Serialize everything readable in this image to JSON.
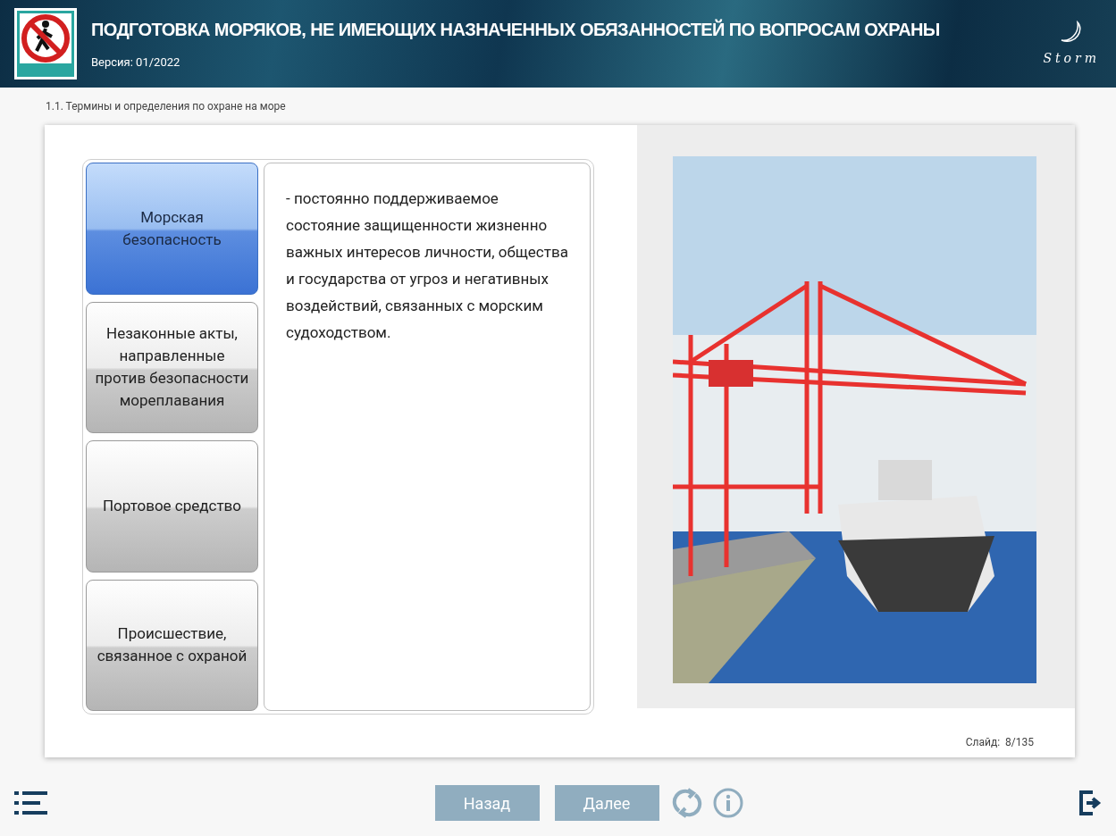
{
  "header": {
    "title": "ПОДГОТОВКА МОРЯКОВ, НЕ ИМЕЮЩИХ НАЗНАЧЕННЫХ ОБЯЗАННОСТЕЙ ПО ВОПРОСАМ ОХРАНЫ",
    "version": "Версия: 01/2022",
    "logo_text": "Storm"
  },
  "breadcrumb": "1.1. Термины и определения по охране на море",
  "terms": [
    {
      "label": "Морская безопасность",
      "selected": true
    },
    {
      "label": "Незаконные акты, направленные против безопасности мореплавания",
      "selected": false
    },
    {
      "label": "Портовое средство",
      "selected": false
    },
    {
      "label": "Происшествие, связанное с охраной",
      "selected": false
    }
  ],
  "definition": "- постоянно поддерживаемое состояние защищенности жизненно важных интересов личности, общества и государства от угроз и негативных воздействий, связанных с морским судоходством.",
  "slide_counter": "Слайд:  8/135",
  "nav_buttons": [
    "Назад",
    "Далее"
  ]
}
